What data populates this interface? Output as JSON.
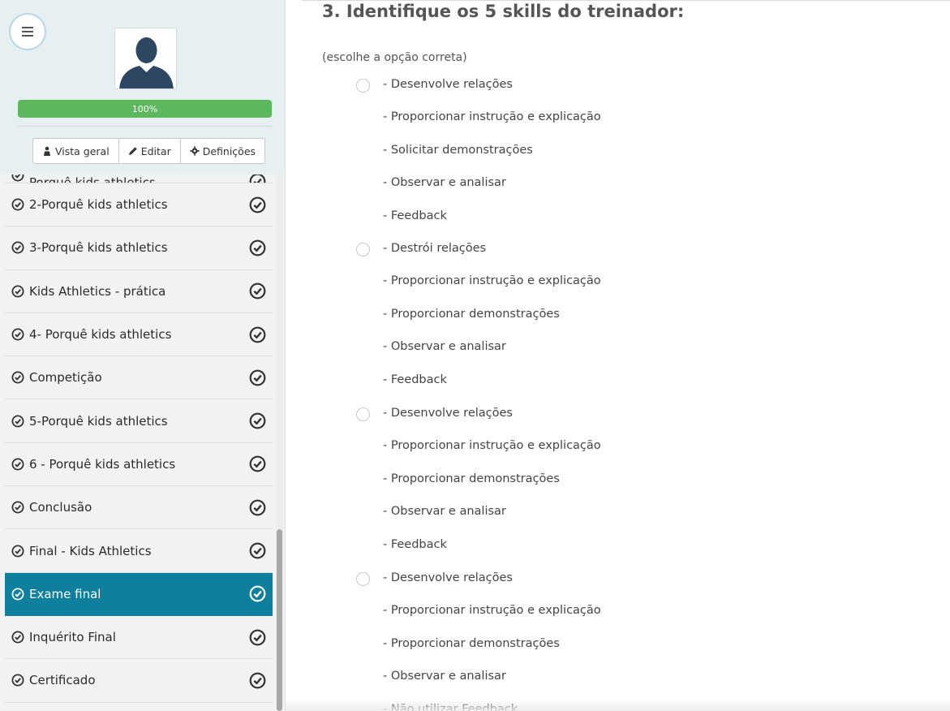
{
  "profile": {
    "progress_label": "100%",
    "progress_value": 1.0,
    "buttons": [
      {
        "label": "Vista geral",
        "icon": "person-icon"
      },
      {
        "label": "Editar",
        "icon": "pencil-icon"
      },
      {
        "label": "Definições",
        "icon": "gear-icon"
      }
    ]
  },
  "sidebar": {
    "items": [
      {
        "label": "Porquê kids athletics",
        "partial": true
      },
      {
        "label": "2-Porquê kids athletics"
      },
      {
        "label": "3-Porquê kids athletics"
      },
      {
        "label": "Kids Athletics - prática"
      },
      {
        "label": "4- Porquê kids athletics"
      },
      {
        "label": "Competição"
      },
      {
        "label": "5-Porquê kids athletics"
      },
      {
        "label": "6 - Porquê kids athletics"
      },
      {
        "label": "Conclusão"
      },
      {
        "label": "Final - Kids Athletics"
      },
      {
        "label": "Exame final",
        "active": true
      },
      {
        "label": "Inquérito Final"
      },
      {
        "label": "Certificado"
      }
    ],
    "active_color": "#0e7f9c"
  },
  "question": {
    "title": "3. Identifique os 5 skills do treinador:",
    "subtitle": "(escolhe a opção correta)",
    "options": [
      {
        "lines": [
          "- Desenvolve relações",
          "- Proporcionar instrução e explicação",
          "- Solicitar demonstrações",
          "- Observar e analisar",
          "- Feedback"
        ]
      },
      {
        "lines": [
          "- Destrói relações",
          "- Proporcionar instrução e explicação",
          "- Proporcionar demonstrações",
          "- Observar e analisar",
          "- Feedback"
        ]
      },
      {
        "lines": [
          "- Desenvolve relações",
          "- Proporcionar instrução e explicação",
          "- Proporcionar demonstrações",
          "- Observar e analisar",
          "- Feedback"
        ]
      },
      {
        "lines": [
          "- Desenvolve relações",
          "- Proporcionar instrução e explicação",
          "- Proporcionar demonstrações",
          "- Observar e analisar",
          "- Não utilizar Feedback"
        ]
      }
    ]
  }
}
